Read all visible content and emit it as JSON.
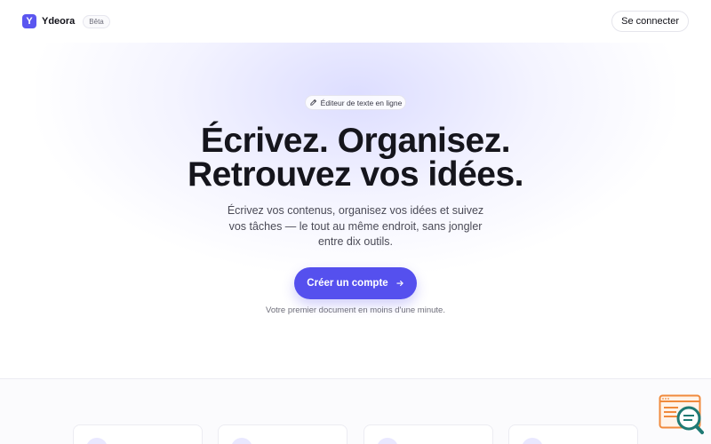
{
  "app": {
    "brand_initial": "Y",
    "name": "Ydeora",
    "badge": "Bêta"
  },
  "header": {
    "login_label": "Se connecter"
  },
  "hero": {
    "pill_label": "Éditeur de texte en ligne",
    "pill_icon": "pencil-icon",
    "headline_line1": "Écrivez. Organisez.",
    "headline_line2": "Retrouvez vos idées.",
    "subtitle": "Écrivez vos contenus, organisez vos idées et suivez vos tâches — le tout au même endroit, sans jongler entre dix outils.",
    "cta_label": "Créer un compte",
    "cta_icon": "arrow-right-icon",
    "note": "Votre premier document en moins d'une minute."
  },
  "colors": {
    "accent": "#5550ee",
    "logo": "#5b56f0",
    "widget": "#f08a3c",
    "widget_lens": "#1f7a74"
  }
}
